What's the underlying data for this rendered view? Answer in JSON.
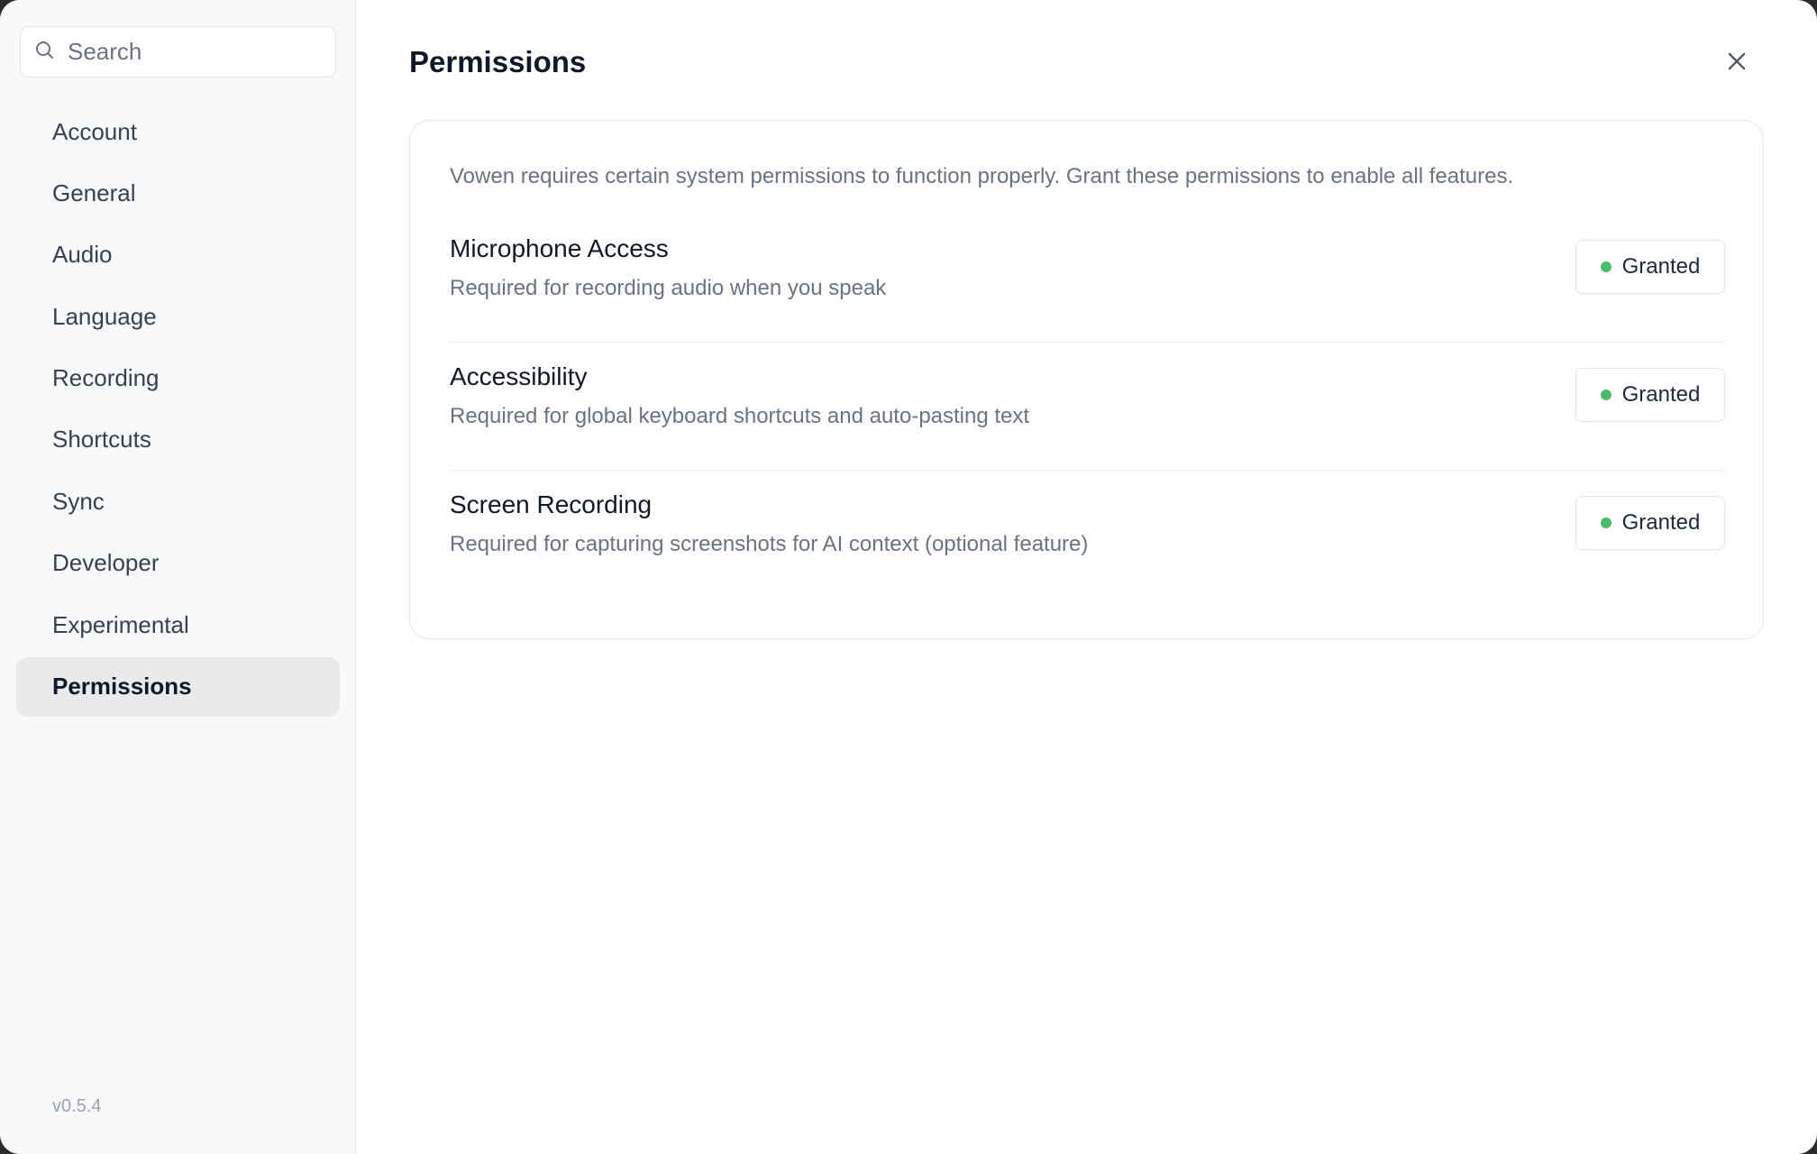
{
  "sidebar": {
    "search": {
      "placeholder": "Search",
      "icon": "search-icon"
    },
    "items": [
      {
        "label": "Account"
      },
      {
        "label": "General"
      },
      {
        "label": "Audio"
      },
      {
        "label": "Language"
      },
      {
        "label": "Recording"
      },
      {
        "label": "Shortcuts"
      },
      {
        "label": "Sync"
      },
      {
        "label": "Developer"
      },
      {
        "label": "Experimental"
      },
      {
        "label": "Permissions",
        "active": true
      }
    ],
    "version": "v0.5.4"
  },
  "main": {
    "title": "Permissions",
    "close_icon": "close-icon",
    "card": {
      "intro": "Vowen requires certain system permissions to function properly. Grant these permissions to enable all features.",
      "permissions": [
        {
          "title": "Microphone Access",
          "description": "Required for recording audio when you speak",
          "status": "Granted"
        },
        {
          "title": "Accessibility",
          "description": "Required for global keyboard shortcuts and auto-pasting text",
          "status": "Granted"
        },
        {
          "title": "Screen Recording",
          "description": "Required for capturing screenshots for AI context (optional feature)",
          "status": "Granted"
        }
      ]
    }
  },
  "colors": {
    "sidebar_bg": "#f8f9fb",
    "active_item_bg": "#e9eaec",
    "granted_dot": "#4cbb6a",
    "text_primary": "#111827",
    "text_secondary": "#6b7280"
  }
}
